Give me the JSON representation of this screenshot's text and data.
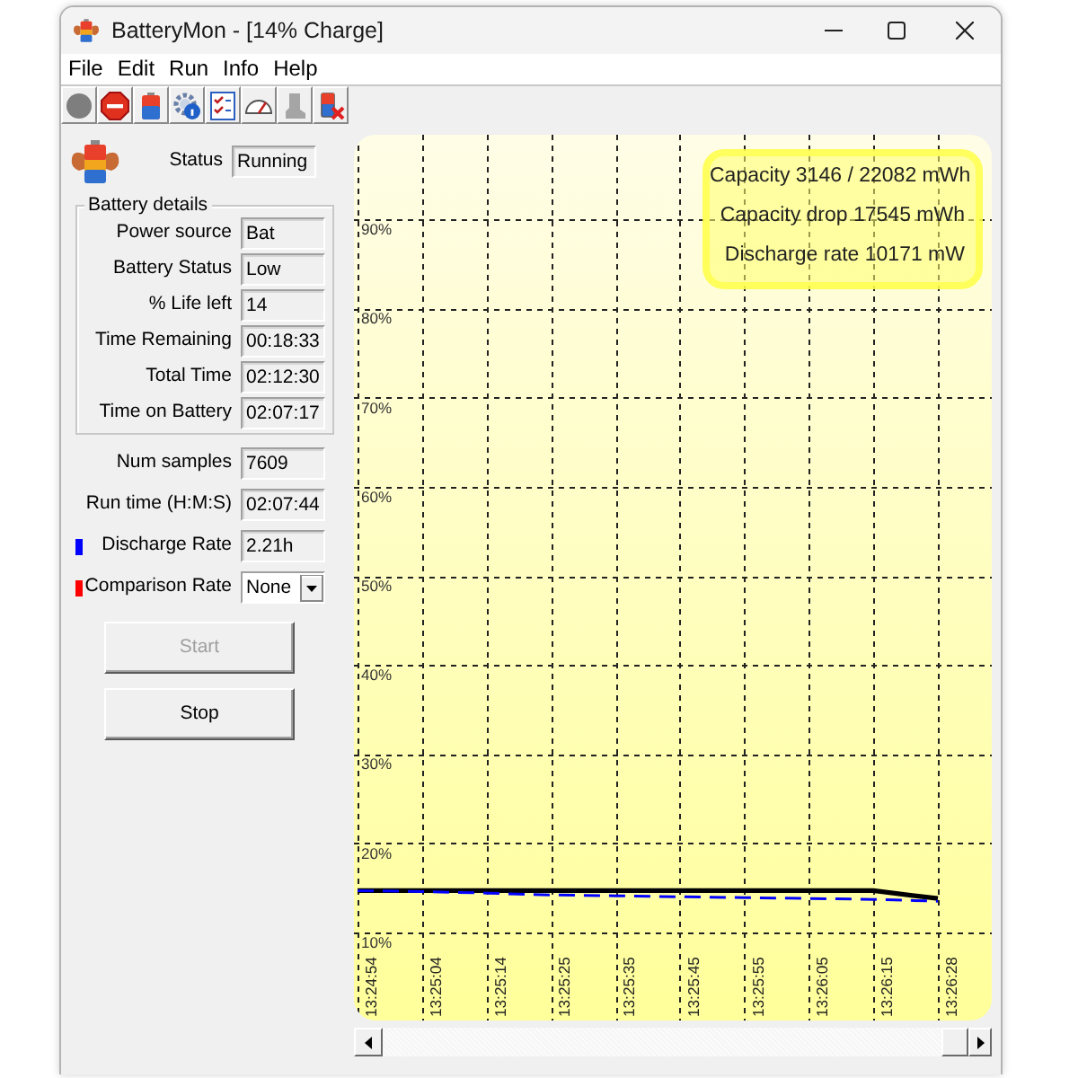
{
  "window": {
    "title": "BatteryMon - [14% Charge]"
  },
  "menu": [
    "File",
    "Edit",
    "Run",
    "Info",
    "Help"
  ],
  "toolbar": [
    {
      "kind": "circle",
      "disabled": true
    },
    {
      "kind": "stop",
      "disabled": false
    },
    {
      "kind": "battery",
      "disabled": false
    },
    {
      "kind": "gear",
      "disabled": false
    },
    {
      "kind": "checklist",
      "disabled": false
    },
    {
      "kind": "gauge",
      "disabled": false
    },
    {
      "kind": "boot",
      "disabled": true
    },
    {
      "kind": "batteryx",
      "disabled": false
    }
  ],
  "status": {
    "label": "Status",
    "value": "Running"
  },
  "battery_details": {
    "title": "Battery details",
    "fields": [
      {
        "label": "Power source",
        "value": "Bat"
      },
      {
        "label": "Battery Status",
        "value": "Low"
      },
      {
        "label": "% Life left",
        "value": "14"
      },
      {
        "label": "Time Remaining",
        "value": "00:18:33"
      },
      {
        "label": "Total Time",
        "value": "02:12:30"
      },
      {
        "label": "Time on Battery",
        "value": "02:07:17"
      }
    ]
  },
  "stats": [
    {
      "label": "Num samples",
      "value": "7609"
    },
    {
      "label": "Run time (H:M:S)",
      "value": "02:07:44"
    }
  ],
  "rates": [
    {
      "kind": "field",
      "label": "Discharge Rate",
      "value": "2.21h",
      "color": "#0000ff"
    },
    {
      "kind": "dropdown",
      "label": "Comparison Rate",
      "value": "None",
      "color": "#ff0000"
    }
  ],
  "buttons": [
    {
      "label": "Start",
      "disabled": true
    },
    {
      "label": "Stop",
      "disabled": false
    }
  ],
  "chart": {
    "info": [
      "Capacity 3146 / 22082 mWh",
      "Capacity drop 17545 mWh",
      "Discharge rate 10171 mW"
    ],
    "chart_data": {
      "type": "line",
      "grid": true,
      "categories": [
        "13:24:54",
        "13:25:04",
        "13:25:14",
        "13:25:25",
        "13:25:35",
        "13:25:45",
        "13:25:55",
        "13:26:05",
        "13:26:15",
        "13:26:28"
      ],
      "series": [
        {
          "color": "#000000",
          "line_style": "solid",
          "values": [
            14.7,
            14.7,
            14.7,
            14.7,
            14.7,
            14.7,
            14.7,
            14.7,
            14.7,
            13.8
          ]
        },
        {
          "color": "#0000ff",
          "line_style": "dashed",
          "values": [
            14.7,
            14.6,
            14.4,
            14.2,
            14.1,
            14.0,
            13.9,
            13.8,
            13.7,
            13.5
          ]
        }
      ],
      "ylim": [
        0,
        100
      ],
      "yticks": [
        {
          "value": 10,
          "label": "10%"
        },
        {
          "value": 20,
          "label": "20%"
        },
        {
          "value": 30,
          "label": "30%"
        },
        {
          "value": 40,
          "label": "40%"
        },
        {
          "value": 50,
          "label": "50%"
        },
        {
          "value": 60,
          "label": "60%"
        },
        {
          "value": 70,
          "label": "70%"
        },
        {
          "value": 80,
          "label": "80%"
        },
        {
          "value": 90,
          "label": "90%"
        }
      ]
    }
  }
}
